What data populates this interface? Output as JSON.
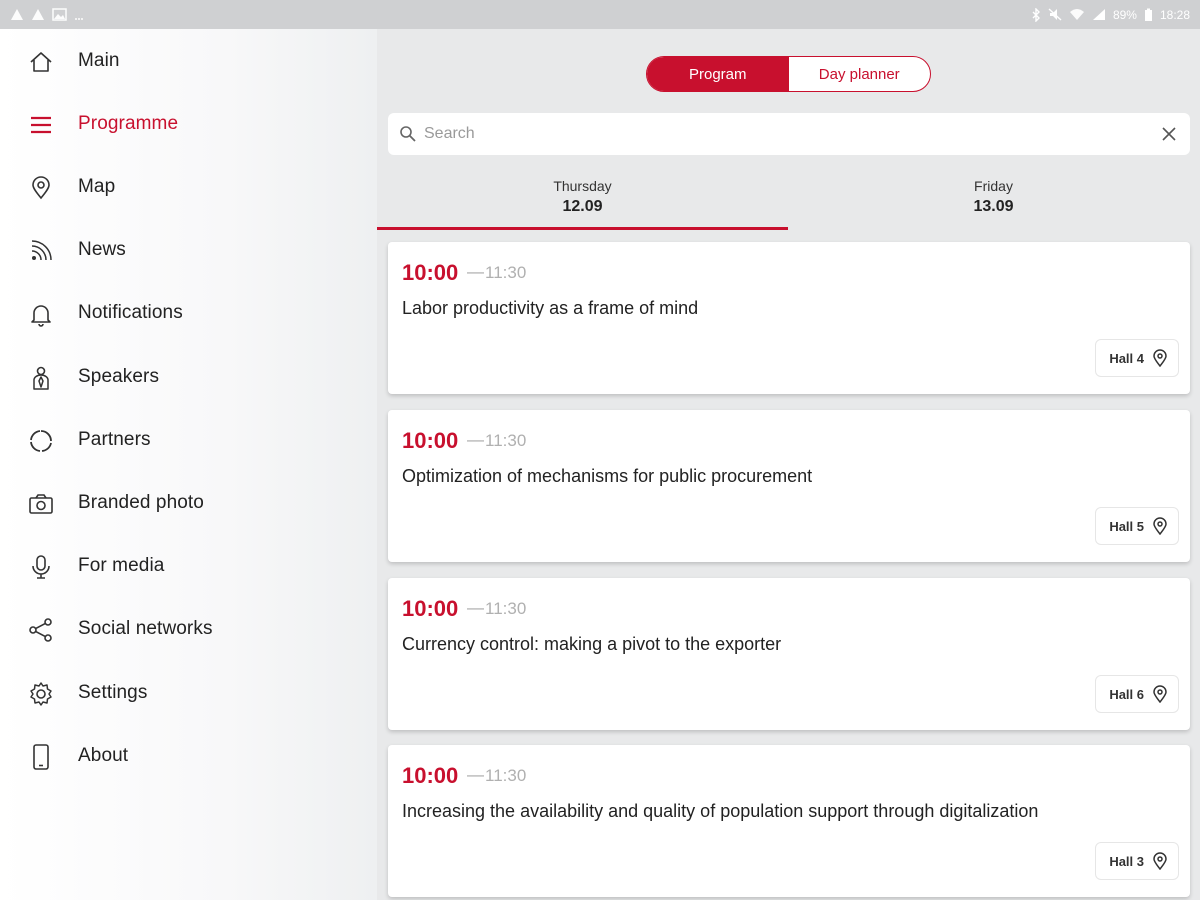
{
  "status_bar": {
    "time": "18:28",
    "battery": "89%"
  },
  "menu": {
    "active_color": "#c8102e",
    "items": [
      {
        "label": "Main",
        "icon": "home-icon"
      },
      {
        "label": "Programme",
        "icon": "menu-lines-icon",
        "active": true
      },
      {
        "label": "Map",
        "icon": "map-pin-icon"
      },
      {
        "label": "News",
        "icon": "rss-icon"
      },
      {
        "label": "Notifications",
        "icon": "bell-icon"
      },
      {
        "label": "Speakers",
        "icon": "speaker-person-icon"
      },
      {
        "label": "Partners",
        "icon": "partners-circle-icon"
      },
      {
        "label": "Branded photo",
        "icon": "camera-icon"
      },
      {
        "label": "For media",
        "icon": "microphone-icon"
      },
      {
        "label": "Social networks",
        "icon": "share-icon"
      },
      {
        "label": "Settings",
        "icon": "gear-icon"
      },
      {
        "label": "About",
        "icon": "phone-icon"
      }
    ]
  },
  "segment": {
    "program_label": "Program",
    "planner_label": "Day planner",
    "selected": "Program"
  },
  "search": {
    "placeholder": "Search",
    "value": ""
  },
  "days": [
    {
      "day": "Thursday",
      "date": "12.09",
      "selected": true
    },
    {
      "day": "Friday",
      "date": "13.09",
      "selected": false
    }
  ],
  "sessions": [
    {
      "start": "10:00",
      "end": "11:30",
      "title": "Labor productivity as a frame of mind",
      "hall": "Hall 4"
    },
    {
      "start": "10:00",
      "end": "11:30",
      "title": "Optimization of mechanisms for public procurement",
      "hall": "Hall 5"
    },
    {
      "start": "10:00",
      "end": "11:30",
      "title": "Currency control: making a pivot to the exporter",
      "hall": "Hall 6"
    },
    {
      "start": "10:00",
      "end": "11:30",
      "title": "Increasing the availability and quality of population support through digitalization",
      "hall": "Hall 3"
    }
  ]
}
